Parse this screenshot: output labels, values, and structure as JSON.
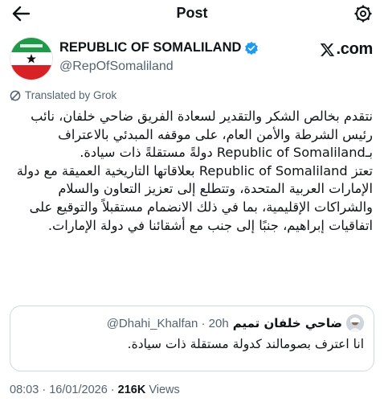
{
  "header": {
    "title": "Post",
    "back_icon": "arrow-left-icon",
    "settings_icon": "gear-icon"
  },
  "author": {
    "name": "REPUBLIC OF SOMALILAND",
    "handle": "@RepOfSomaliland",
    "verified": true,
    "verified_color": "#1d9bf0",
    "avatar_colors": {
      "green": "#1f9a4a",
      "white": "#ffffff",
      "red": "#d82127",
      "star": "#111111"
    }
  },
  "brand": {
    "logo_text": ".com"
  },
  "translation": {
    "label": "Translated by Grok"
  },
  "post": {
    "paragraph1": "نتقدم بخالص الشكر والتقدير لسعادة الفريق ضاحي خلفان، نائب رئيس الشرطة والأمن العام، على موقفه المبدئي بالاعتراف بـRepublic of Somaliland دولةً مستقلةً ذات سيادة.",
    "paragraph2": "تعتز Republic of Somaliland بعلاقاتها التاريخية العميقة مع دولة الإمارات العربية المتحدة، وتتطلع إلى تعزيز التعاون والسلام والشراكات الإقليمية، بما في ذلك الانضمام مستقبلاً والتوقيع على اتفاقيات إبراهيم، جنبًا إلى جنب مع أشقائنا في دولة الإمارات."
  },
  "quote": {
    "name": "ضاحي خلفان تميم",
    "handle": "@Dhahi_Khalfan",
    "time": "20h",
    "text": "انا اعترف بصومالند كدولة مستقلة ذات سيادة."
  },
  "meta": {
    "time": "08:03",
    "date": "16/01/2026",
    "views": "216K",
    "views_label": "Views"
  }
}
